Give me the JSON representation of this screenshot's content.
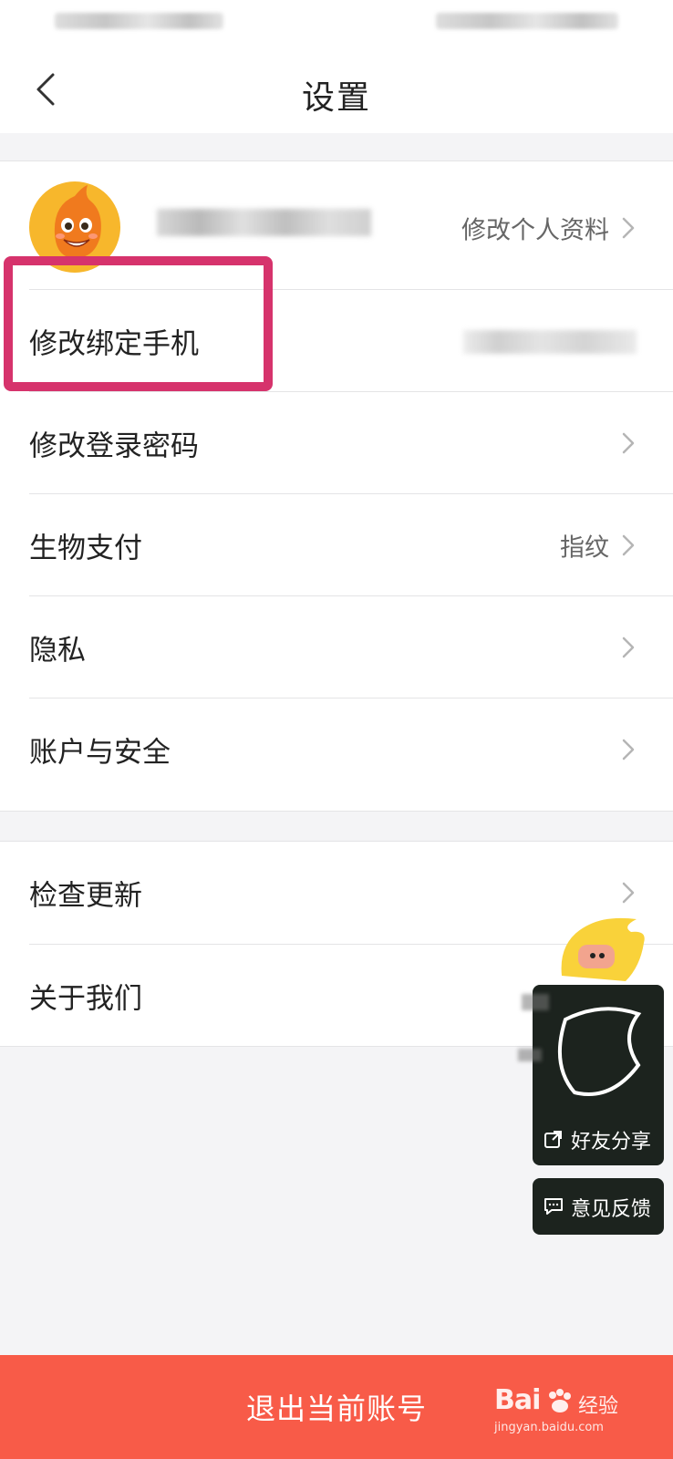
{
  "header": {
    "title": "设置"
  },
  "profile": {
    "edit_label": "修改个人资料"
  },
  "account_section": {
    "rows": [
      {
        "label": "修改绑定手机",
        "value": ""
      },
      {
        "label": "修改登录密码",
        "value": ""
      },
      {
        "label": "生物支付",
        "value": "指纹"
      },
      {
        "label": "隐私",
        "value": ""
      },
      {
        "label": "账户与安全",
        "value": ""
      }
    ]
  },
  "about_section": {
    "rows": [
      {
        "label": "检查更新"
      },
      {
        "label": "关于我们"
      }
    ]
  },
  "floating_widget": {
    "share_label": "好友分享",
    "feedback_label": "意见反馈"
  },
  "footer": {
    "logout_label": "退出当前账号"
  },
  "watermark": {
    "logo_text": "Bai",
    "logo_text_2": "经验",
    "url": "jingyan.baidu.com"
  },
  "colors": {
    "accent": "#f85b48",
    "highlight": "#d6336c",
    "background": "#f4f4f6"
  }
}
